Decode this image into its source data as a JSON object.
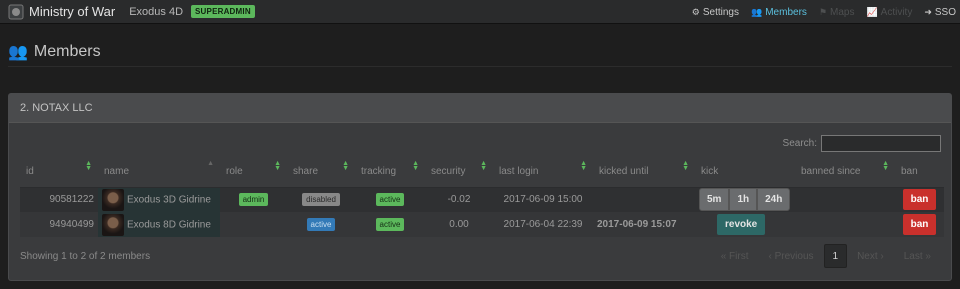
{
  "navbar": {
    "brand": "Ministry of War",
    "character": "Exodus 4D",
    "role_badge": "SUPERADMIN",
    "items": [
      {
        "label": "Settings",
        "icon": "gears-icon"
      },
      {
        "label": "Members",
        "icon": "users-icon"
      },
      {
        "label": "Maps",
        "icon": "flag-icon"
      },
      {
        "label": "Activity",
        "icon": "chart-icon"
      },
      {
        "label": "SSO",
        "icon": "sign-in-icon"
      }
    ]
  },
  "page": {
    "title": "Members"
  },
  "panel": {
    "title": "2. NOTAX LLC",
    "search_label": "Search:",
    "search_value": "",
    "columns": [
      "id",
      "name",
      "role",
      "share",
      "tracking",
      "security",
      "last login",
      "kicked until",
      "kick",
      "banned since",
      "ban"
    ],
    "rows": [
      {
        "id": "90581222",
        "name": "Exodus 3D Gidrine",
        "role": "admin",
        "share": "disabled",
        "tracking": "active",
        "security": "-0.02",
        "last_login": "2017-06-09 15:00",
        "kicked_until": "",
        "kick_options": [
          "5m",
          "1h",
          "24h"
        ],
        "banned_since": "",
        "ban": "ban"
      },
      {
        "id": "94940499",
        "name": "Exodus 8D Gidrine",
        "role": "",
        "share": "active",
        "tracking": "active",
        "security": "0.00",
        "last_login": "2017-06-04 22:39",
        "kicked_until": "2017-06-09 15:07",
        "revoke": "revoke",
        "banned_since": "",
        "ban": "ban"
      }
    ],
    "info": "Showing 1 to 2 of 2 members",
    "pagination": {
      "first": "« First",
      "previous": "‹ Previous",
      "current": "1",
      "next": "Next ›",
      "last": "Last »"
    }
  },
  "colors": {
    "accent_blue": "#5bc0de",
    "success": "#5cb85c",
    "warning": "#f0ad4e",
    "danger": "#c9302c"
  }
}
